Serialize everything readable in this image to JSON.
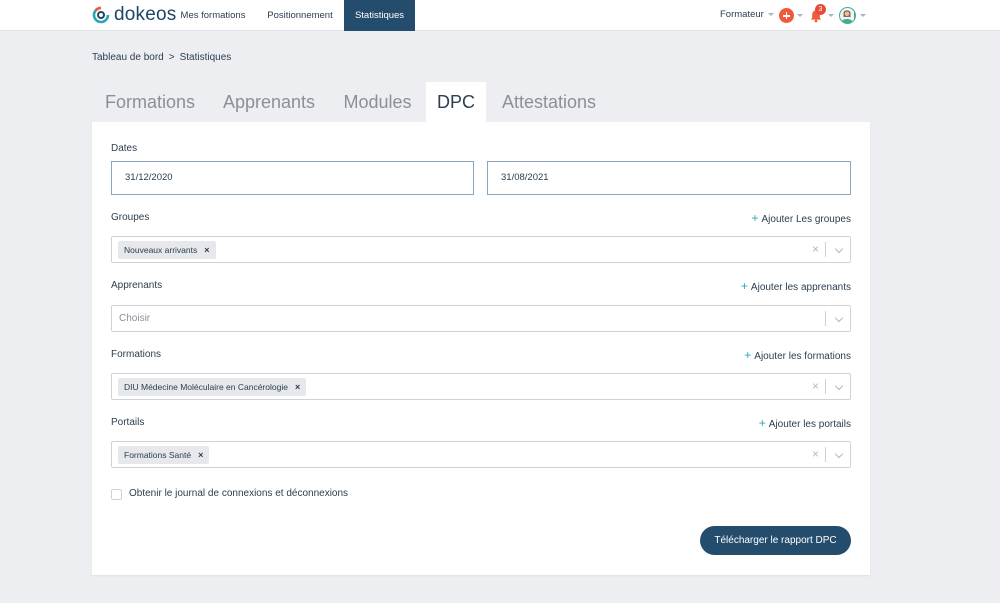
{
  "brand": {
    "name": "dokeos",
    "color": "#1f4565",
    "accent": "#2aa7b4"
  },
  "nav": {
    "items": [
      {
        "label": "Mes formations",
        "active": false
      },
      {
        "label": "Positionnement",
        "active": false
      },
      {
        "label": "Statistiques",
        "active": true
      }
    ]
  },
  "topright": {
    "role": "Formateur",
    "notification_count": "3",
    "icons": [
      "plus-circle-icon",
      "bell-icon",
      "avatar"
    ]
  },
  "breadcrumb": {
    "parent": "Tableau de bord",
    "separator": ">",
    "current": "Statistiques"
  },
  "tabs": [
    {
      "label": "Formations",
      "active": false
    },
    {
      "label": "Apprenants",
      "active": false
    },
    {
      "label": "Modules",
      "active": false
    },
    {
      "label": "DPC",
      "active": true
    },
    {
      "label": "Attestations",
      "active": false
    }
  ],
  "form": {
    "dates": {
      "label": "Dates",
      "start": "31/12/2020",
      "end": "31/08/2021"
    },
    "groupes": {
      "label": "Groupes",
      "add_label": "Ajouter Les groupes",
      "selected": [
        "Nouveaux arrivants"
      ]
    },
    "apprenants": {
      "label": "Apprenants",
      "add_label": "Ajouter les apprenants",
      "placeholder": "Choisir"
    },
    "formations": {
      "label": "Formations",
      "add_label": "Ajouter les formations",
      "selected": [
        "DIU Médecine Moléculaire en Cancérologie"
      ]
    },
    "portails": {
      "label": "Portails",
      "add_label": "Ajouter les portails",
      "selected": [
        "Formations Santé"
      ]
    },
    "journal": {
      "label": "Obtenir le journal de connexions et déconnexions",
      "checked": false
    },
    "submit_label": "Télécharger le rapport DPC",
    "chip_remove": "×",
    "clear": "×",
    "add_icon": "+"
  },
  "colors": {
    "primary": "#244d6d",
    "notification": "#e54b3c",
    "plus_button": "#f05a3c",
    "input_border_active": "#8aa6c1"
  }
}
